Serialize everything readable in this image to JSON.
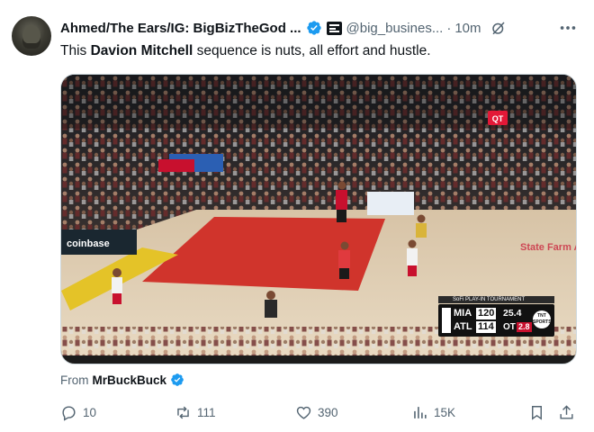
{
  "post": {
    "display_name": "Ahmed/The Ears/IG: BigBizTheGod ...",
    "handle": "@big_busines...",
    "separator": "·",
    "time": "10m",
    "text_before": "This ",
    "text_bold": "Davion Mitchell",
    "text_after": " sequence is nuts, all effort and hustle.",
    "from_label": "From",
    "from_source": "MrBuckBuck"
  },
  "video": {
    "channel_badge": "QT",
    "sponsor": "coinbase",
    "arena": "State Farm ARENA",
    "tournament_tag": "SoFi PLAY-IN TOURNAMENT",
    "score": {
      "home_team": "MIA",
      "home_score": "120",
      "away_team": "ATL",
      "away_score": "114",
      "clock": "25.4",
      "period": "OT",
      "shot_clock": "2.8",
      "network": "TNT SPORTS"
    }
  },
  "actions": {
    "replies": "10",
    "reposts": "111",
    "likes": "390",
    "views": "15K"
  },
  "colors": {
    "verified_blue": "#1d9bf0",
    "muted_text": "#536471"
  }
}
